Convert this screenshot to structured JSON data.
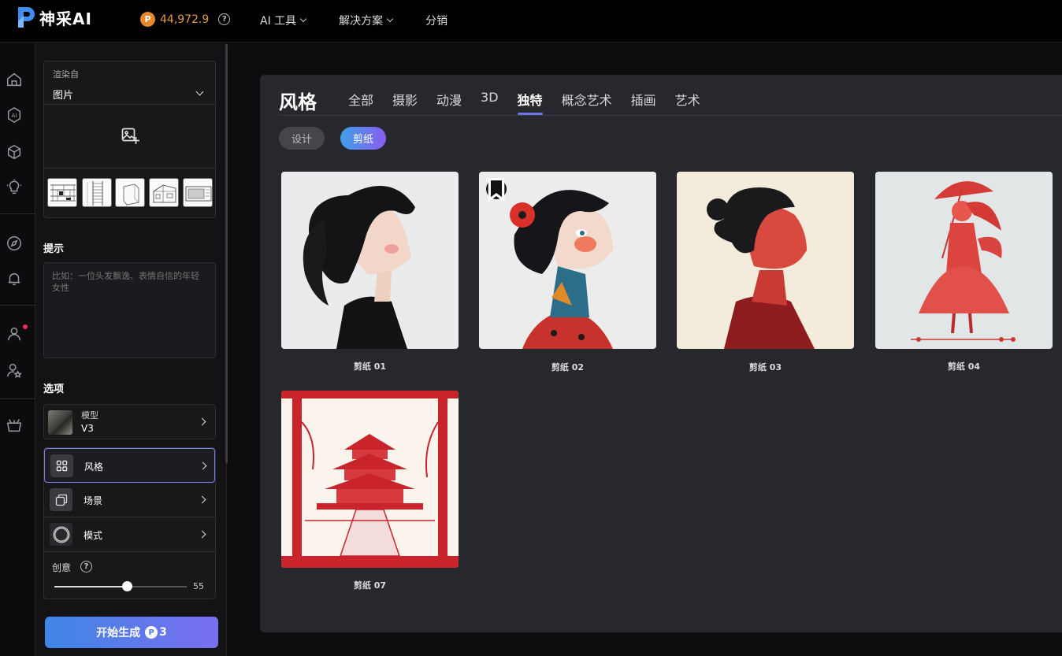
{
  "header": {
    "brand": "神采AI",
    "credits": "44,972.9",
    "coin_symbol": "P",
    "help_symbol": "?",
    "nav": [
      {
        "label": "AI 工具",
        "has_dropdown": true
      },
      {
        "label": "解决方案",
        "has_dropdown": true
      },
      {
        "label": "分销",
        "has_dropdown": false
      }
    ]
  },
  "rail": {
    "icons": [
      "home-icon",
      "ai-icon",
      "cube-icon",
      "lightbulb-icon",
      "compass-icon",
      "bell-icon",
      "user-icon",
      "user-star-icon",
      "basket-icon"
    ]
  },
  "panel": {
    "render_label": "渲染自",
    "render_value": "图片",
    "prompt_title": "提示",
    "prompt_placeholder": "比如：一位头发飘逸、表情自信的年轻女性",
    "options_title": "选项",
    "model_label": "模型",
    "model_value": "V3",
    "options": [
      {
        "label": "风格",
        "icon": "grid-icon",
        "active": true
      },
      {
        "label": "场景",
        "icon": "layers-icon",
        "active": false
      },
      {
        "label": "模式",
        "icon": "ring-icon",
        "active": false
      }
    ],
    "creativity_label": "创意",
    "creativity_value": "55",
    "creativity_fraction": 0.55,
    "generate_label": "开始生成",
    "generate_cost": "3"
  },
  "main": {
    "title": "风格",
    "tabs": [
      {
        "label": "全部",
        "active": false
      },
      {
        "label": "摄影",
        "active": false
      },
      {
        "label": "动漫",
        "active": false
      },
      {
        "label": "3D",
        "active": false
      },
      {
        "label": "独特",
        "active": true
      },
      {
        "label": "概念艺术",
        "active": false
      },
      {
        "label": "插画",
        "active": false
      },
      {
        "label": "艺术",
        "active": false
      }
    ],
    "chips": [
      {
        "label": "设计",
        "active": false
      },
      {
        "label": "剪纸",
        "active": true
      }
    ],
    "tiles": [
      {
        "caption": "剪纸 01"
      },
      {
        "caption": "剪纸 02"
      },
      {
        "caption": "剪纸 03"
      },
      {
        "caption": "剪纸 04"
      },
      {
        "caption": "剪纸 07"
      }
    ]
  },
  "colors": {
    "accent": "#6f74e6",
    "credit": "#e59a3b",
    "generate_start": "#3e86e4",
    "generate_end": "#7b6ef0"
  }
}
